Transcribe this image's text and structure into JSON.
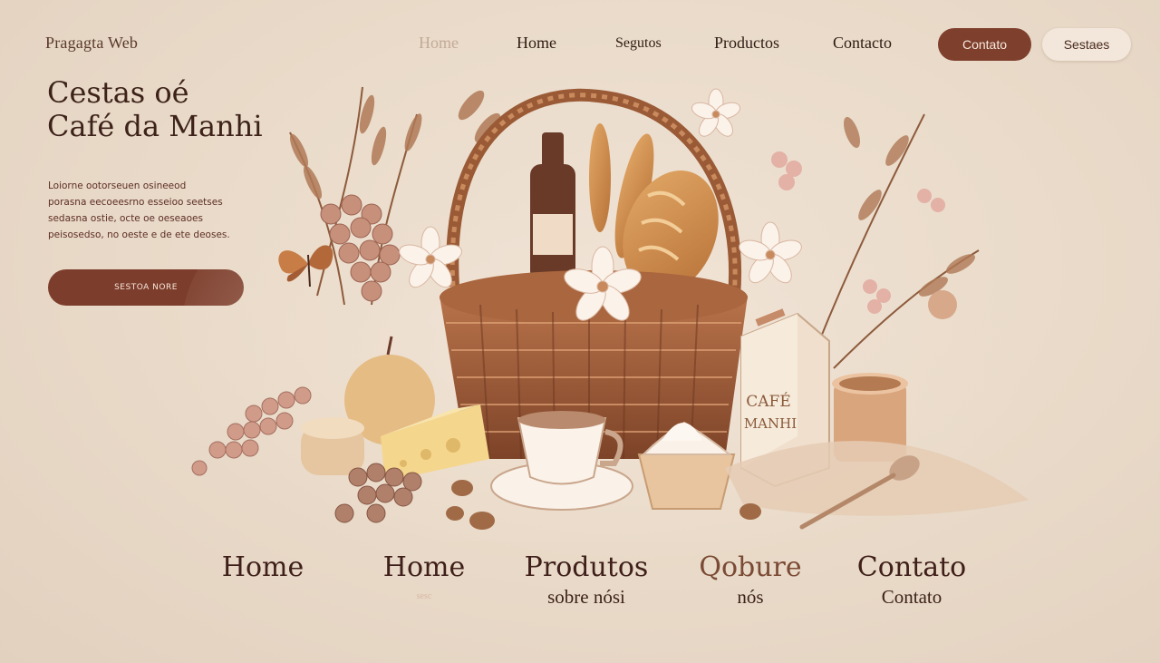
{
  "header": {
    "brand": "Pragagta Web",
    "nav": [
      {
        "label": "Home",
        "style": "faded"
      },
      {
        "label": "Home",
        "style": "normal"
      },
      {
        "label": "Segutos",
        "style": "small"
      },
      {
        "label": "Productos",
        "style": "normal"
      },
      {
        "label": "Contacto",
        "style": "normal"
      }
    ],
    "pill_primary": "Contato",
    "pill_secondary": "Sestaes"
  },
  "hero": {
    "title_line1": "Cestas oé",
    "title_line2": "Café da Manhi",
    "description_lines": [
      "Loiorne ootorseuen osineeod",
      "porasna eecoeesrno esseioo seetses",
      "sedasna ostie, octe oe oeseaoes",
      "peisosedso, no oeste e de ete deoses."
    ],
    "cta": "SESTOA NORE"
  },
  "illustration": {
    "box_label_line1": "CAFÉ",
    "box_label_line2": "MANHI"
  },
  "bottom_menu": [
    {
      "title": "Home",
      "subtitle": "",
      "title_style": "normal"
    },
    {
      "title": "Home",
      "subtitle": "sesc",
      "title_style": "normal",
      "sub_style": "faded"
    },
    {
      "title": "Produtos",
      "subtitle": "sobre nósi",
      "title_style": "normal"
    },
    {
      "title": "Qobure",
      "subtitle": "nós",
      "title_style": "warm"
    },
    {
      "title": "Contato",
      "subtitle": "Contato",
      "title_style": "normal"
    }
  ],
  "colors": {
    "background": "#eadbca",
    "accent": "#7e3f2d",
    "text_dark": "#3d2219"
  }
}
